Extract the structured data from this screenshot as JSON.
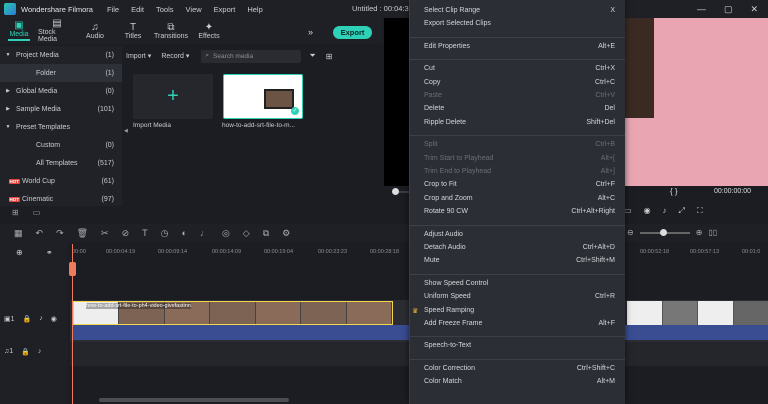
{
  "app": {
    "name": "Wondershare Filmora",
    "menu": [
      "File",
      "Edit",
      "Tools",
      "View",
      "Export",
      "Help"
    ],
    "doc_title": "Untitled : 00:04:3"
  },
  "tabs": [
    {
      "label": "Media",
      "icon": "folder-icon"
    },
    {
      "label": "Stock Media",
      "icon": "stock-media-icon"
    },
    {
      "label": "Audio",
      "icon": "music-note-icon"
    },
    {
      "label": "Titles",
      "icon": "titles-icon"
    },
    {
      "label": "Transitions",
      "icon": "transitions-icon"
    },
    {
      "label": "Effects",
      "icon": "effects-icon"
    }
  ],
  "export_label": "Export",
  "sidebar": [
    {
      "label": "Project Media",
      "count": "(1)",
      "expand": "▼"
    },
    {
      "label": "Folder",
      "count": "(1)",
      "selected": true
    },
    {
      "label": "Global Media",
      "count": "(0)",
      "expand": "▶"
    },
    {
      "label": "Sample Media",
      "count": "(101)",
      "expand": "▶"
    },
    {
      "label": "Preset Templates",
      "count": "",
      "expand": "▼"
    },
    {
      "label": "Custom",
      "count": "(0)"
    },
    {
      "label": "All Templates",
      "count": "(517)"
    },
    {
      "label": "World Cup",
      "count": "(61)",
      "hot": true
    },
    {
      "label": "Cinematic",
      "count": "(97)",
      "hot": true
    }
  ],
  "hot_label": "HOT",
  "toolbar": {
    "import_label": "Import",
    "record_label": "Record",
    "search_placeholder": "Search media"
  },
  "media": {
    "import_label": "Import Media",
    "clip_label": "how-to-add-srt-file-to-m..."
  },
  "preview": {
    "time": "00:00:00:00",
    "brackets": "{   }"
  },
  "timeline": {
    "ticks": [
      "00:00",
      "00:00:04:19",
      "00:00:09:14",
      "00:00:14:09",
      "00:00:19:04",
      "00:00:23:23",
      "00:00:28:18"
    ],
    "right_ticks": [
      "00:00:52:18",
      "00:00:57:13",
      "00:01:0"
    ],
    "clip_name": "how-to-add-srt-file-to-ph4-video-givefastinn"
  },
  "context_menu": [
    {
      "label": "Select Clip Range",
      "shortcut": "X",
      "enabled": true
    },
    {
      "label": "Export Selected Clips",
      "shortcut": "",
      "enabled": true
    },
    {
      "sep": true
    },
    {
      "label": "Edit Properties",
      "shortcut": "Alt+E",
      "enabled": true
    },
    {
      "sep": true
    },
    {
      "label": "Cut",
      "shortcut": "Ctrl+X",
      "enabled": true
    },
    {
      "label": "Copy",
      "shortcut": "Ctrl+C",
      "enabled": true
    },
    {
      "label": "Paste",
      "shortcut": "Ctrl+V",
      "enabled": false
    },
    {
      "label": "Delete",
      "shortcut": "Del",
      "enabled": true
    },
    {
      "label": "Ripple Delete",
      "shortcut": "Shift+Del",
      "enabled": true
    },
    {
      "sep": true
    },
    {
      "label": "Split",
      "shortcut": "Ctrl+B",
      "enabled": false
    },
    {
      "label": "Trim Start to Playhead",
      "shortcut": "Alt+[",
      "enabled": false
    },
    {
      "label": "Trim End to Playhead",
      "shortcut": "Alt+]",
      "enabled": false
    },
    {
      "label": "Crop to Fit",
      "shortcut": "Ctrl+F",
      "enabled": true
    },
    {
      "label": "Crop and Zoom",
      "shortcut": "Alt+C",
      "enabled": true
    },
    {
      "label": "Rotate 90 CW",
      "shortcut": "Ctrl+Alt+Right",
      "enabled": true
    },
    {
      "sep": true
    },
    {
      "label": "Adjust Audio",
      "shortcut": "",
      "enabled": true
    },
    {
      "label": "Detach Audio",
      "shortcut": "Ctrl+Alt+D",
      "enabled": true
    },
    {
      "label": "Mute",
      "shortcut": "Ctrl+Shift+M",
      "enabled": true
    },
    {
      "sep": true
    },
    {
      "label": "Show Speed Control",
      "shortcut": "",
      "enabled": true
    },
    {
      "label": "Uniform Speed",
      "shortcut": "Ctrl+R",
      "enabled": true
    },
    {
      "label": "Speed Ramping",
      "shortcut": "",
      "enabled": true,
      "crown": true
    },
    {
      "label": "Add Freeze Frame",
      "shortcut": "Alt+F",
      "enabled": true
    },
    {
      "sep": true
    },
    {
      "label": "Speech-to-Text",
      "shortcut": "",
      "enabled": true
    },
    {
      "sep": true
    },
    {
      "label": "Color Correction",
      "shortcut": "Ctrl+Shift+C",
      "enabled": true
    },
    {
      "label": "Color Match",
      "shortcut": "Alt+M",
      "enabled": true
    }
  ],
  "colors": {
    "accent": "#2fd0b8",
    "playhead": "#f07b5c",
    "clip_border": "#f2d64b"
  }
}
